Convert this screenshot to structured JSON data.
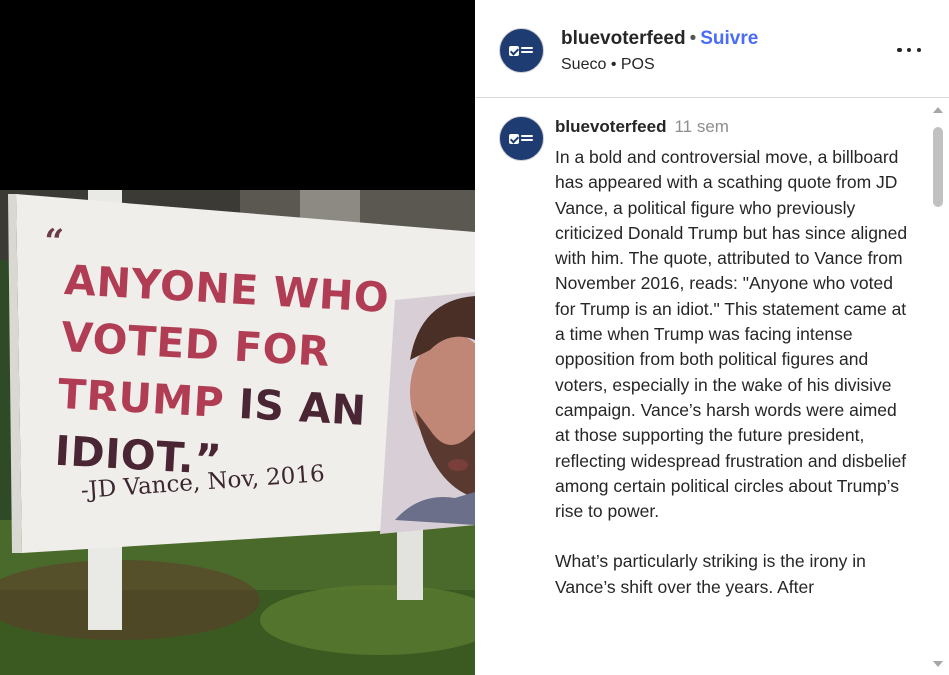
{
  "post": {
    "image": {
      "billboard": {
        "open_quote": "“",
        "lines": [
          {
            "red": "ANYONE WHO",
            "dark": ""
          },
          {
            "red": "VOTED FOR",
            "dark": ""
          },
          {
            "red": "TRUMP ",
            "dark": "IS AN"
          },
          {
            "red": "",
            "dark": "IDIOT.”"
          }
        ],
        "attribution": "-JD Vance, Nov, 2016"
      }
    },
    "header": {
      "username": "bluevoterfeed",
      "separator": "•",
      "follow_label": "Suivre",
      "subtitle": "Sueco • POS",
      "avatar_icon": "blue-voter-feed-logo-icon",
      "more_icon": "more-options-icon"
    },
    "caption": {
      "username": "bluevoterfeed",
      "time": "11 sem",
      "paragraphs": [
        "In a bold and controversial move, a billboard has appeared with a scathing quote from JD Vance, a political figure who previously criticized Donald Trump but has since aligned with him. The quote, attributed to Vance from November 2016, reads: \"Anyone who voted for Trump is an idiot.\" This statement came at a time when Trump was facing intense opposition from both political figures and voters, especially in the wake of his divisive campaign. Vance’s harsh words were aimed at those supporting the future president, reflecting widespread frustration and disbelief among certain political circles about Trump’s rise to power.",
        "What’s particularly striking is the irony in Vance’s shift over the years. After"
      ]
    },
    "colors": {
      "follow_link": "#4a6cf7",
      "avatar_bg": "#1f3c72",
      "quote_red": "#b03d53",
      "quote_dark": "#4a2534"
    }
  }
}
